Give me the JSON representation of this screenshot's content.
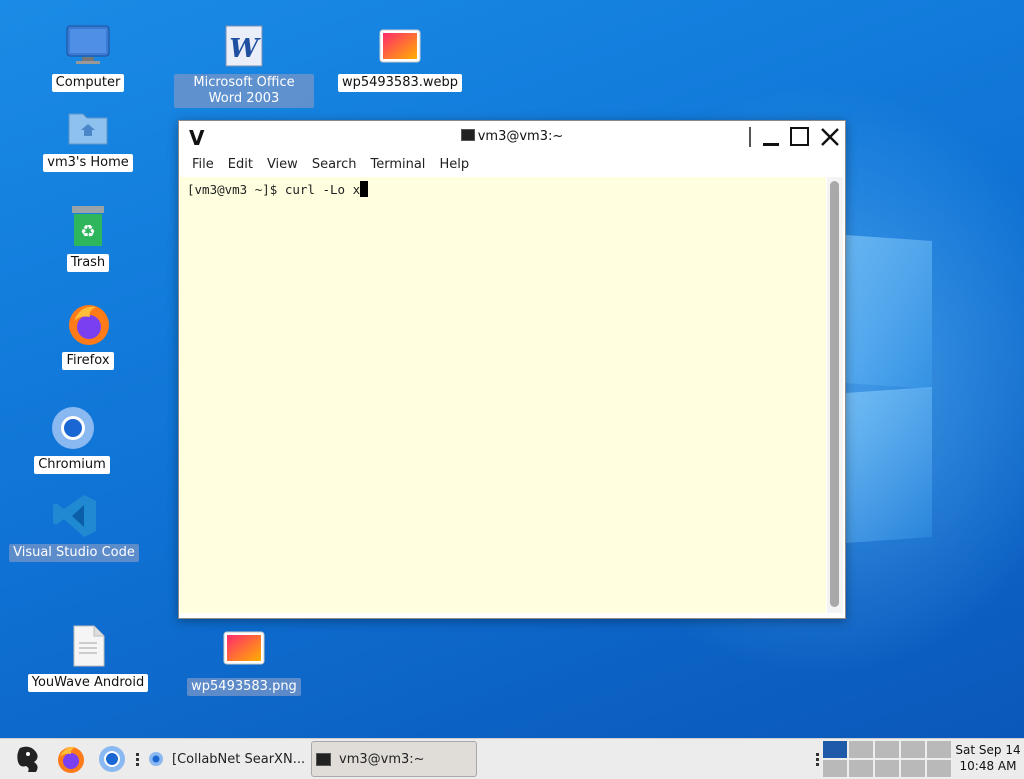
{
  "desktop": {
    "icons": [
      {
        "label": "Computer"
      },
      {
        "label": "Microsoft Office Word 2003"
      },
      {
        "label": "wp5493583.webp"
      },
      {
        "label": "vm3's Home"
      },
      {
        "label": "Trash"
      },
      {
        "label": "Firefox"
      },
      {
        "label": "Chromium"
      },
      {
        "label": "Visual Studio Code"
      },
      {
        "label": "YouWave Android"
      },
      {
        "label": "wp5493583.png"
      }
    ]
  },
  "terminal": {
    "title": "vm3@vm3:~",
    "logo": "V",
    "menu": [
      "File",
      "Edit",
      "View",
      "Search",
      "Terminal",
      "Help"
    ],
    "prompt": "[vm3@vm3 ~]$ ",
    "command": "curl -Lo x"
  },
  "taskbar": {
    "tasks": [
      {
        "label": "[CollabNet SearXN..."
      },
      {
        "label": "vm3@vm3:~"
      }
    ],
    "clock": {
      "date": "Sat Sep 14",
      "time": "10:48 AM"
    }
  },
  "colors": {
    "desktop": "#0f74d6",
    "terminal_bg": "#ffffe0",
    "pager_active": "#1e5aa8"
  }
}
